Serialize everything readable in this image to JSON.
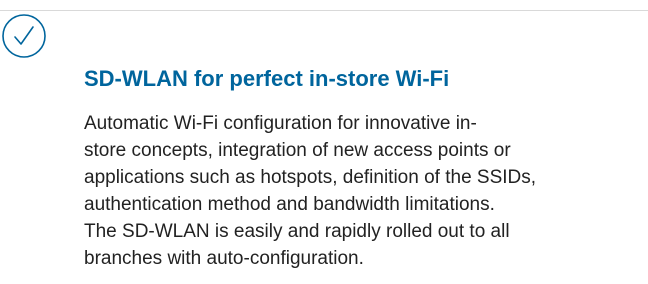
{
  "colors": {
    "accent": "#00659d",
    "text": "#222222",
    "divider": "#d9d9d9",
    "background": "#ffffff"
  },
  "icon": "check-circle-icon",
  "feature": {
    "title": "SD-WLAN for perfect in-store Wi-Fi",
    "description_lines": [
      "Automatic Wi-Fi configuration for innovative in-",
      "store concepts, integration of new access points or",
      "applications such as hotspots, definition of the SSIDs,",
      "authentication method and bandwidth limitations.",
      "The SD-WLAN is easily and rapidly rolled out to all",
      "branches with auto-configuration."
    ]
  }
}
